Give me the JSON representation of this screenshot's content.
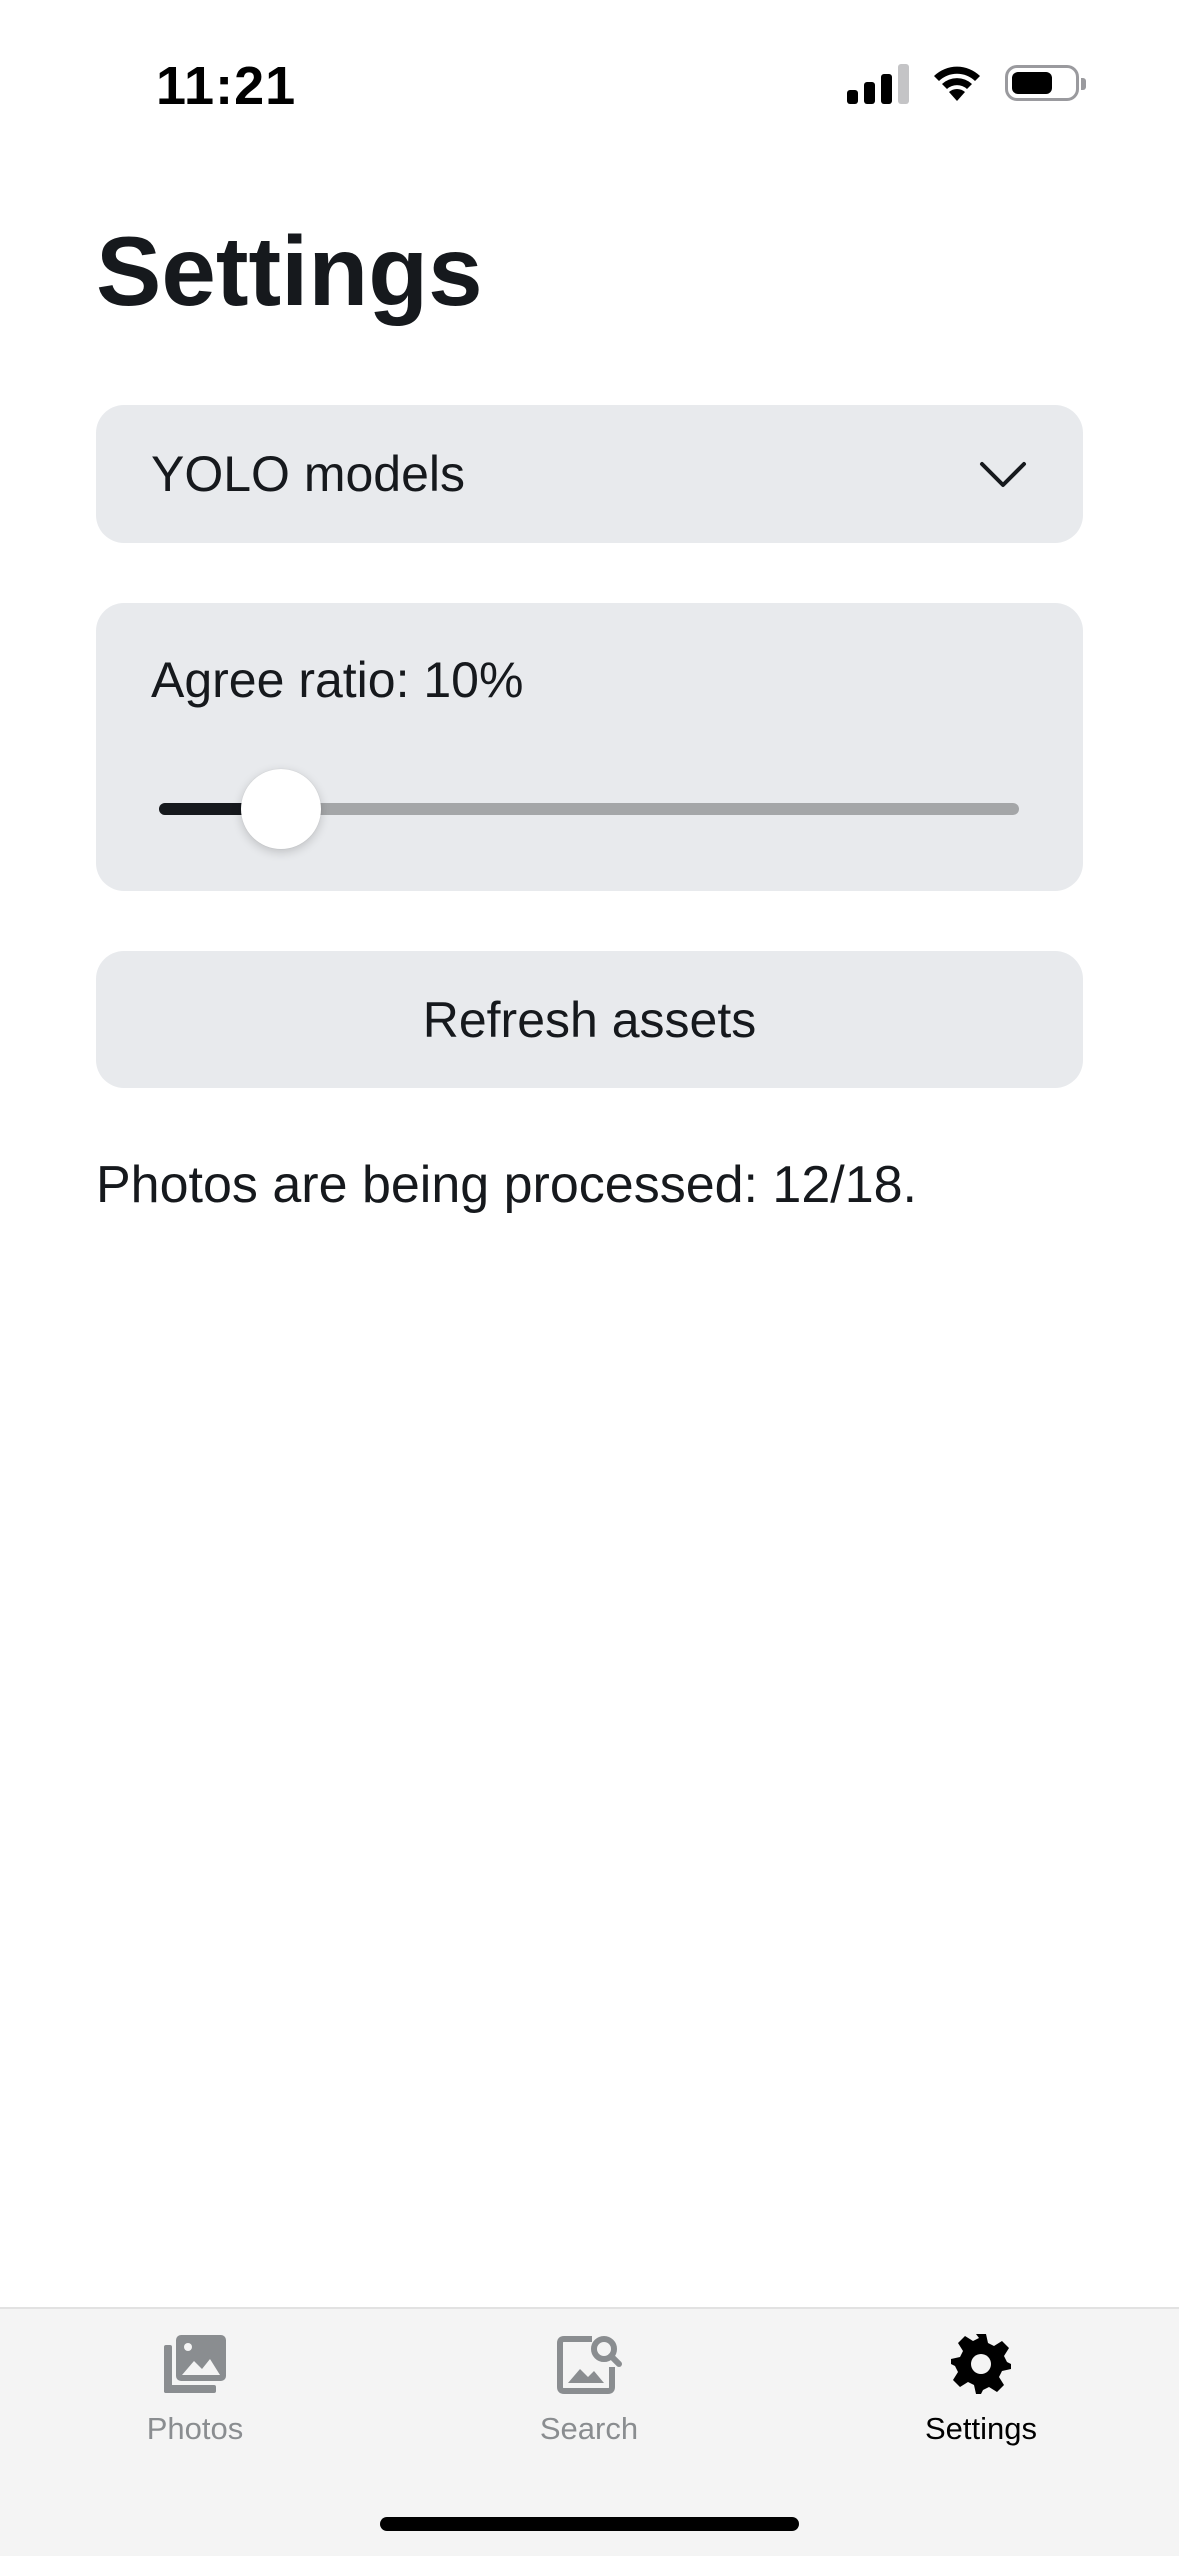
{
  "status_bar": {
    "time": "11:21",
    "icons": [
      "signal-icon",
      "wifi-icon",
      "battery-icon"
    ]
  },
  "page": {
    "title": "Settings"
  },
  "model_select": {
    "selected": "YOLO models",
    "icon": "chevron-down-icon"
  },
  "agree_ratio": {
    "label": "Agree ratio: 10%",
    "value": 0.1
  },
  "refresh": {
    "label": "Refresh assets"
  },
  "processing": {
    "text": "Photos are being processed: 12/18."
  },
  "tabs": [
    {
      "label": "Photos",
      "icon": "photos-icon",
      "active": false
    },
    {
      "label": "Search",
      "icon": "image-search-icon",
      "active": false
    },
    {
      "label": "Settings",
      "icon": "gear-icon",
      "active": true
    }
  ],
  "colors": {
    "card_bg": "#e8eaed",
    "text": "#16191d",
    "inactive_tab": "#8a8d90",
    "active_tab": "#000000",
    "slider_track": "#a4a6a8",
    "slider_fill": "#16191d"
  }
}
